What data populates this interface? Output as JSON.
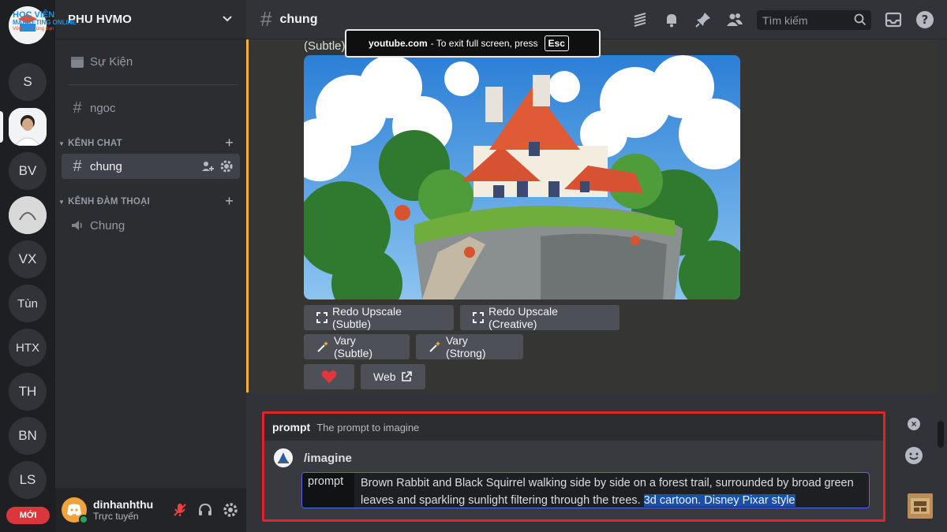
{
  "server_rail": {
    "servers": [
      {
        "abbr": "S"
      },
      {
        "abbr": "BV"
      },
      {
        "abbr": "VX"
      },
      {
        "abbr": "Tùn"
      },
      {
        "abbr": "HTX"
      },
      {
        "abbr": "TH"
      },
      {
        "abbr": "BN"
      },
      {
        "abbr": "LS"
      }
    ],
    "new_badge": "MỚI"
  },
  "guild": {
    "name": "PHU HVMO",
    "logo_text": "HỌC VIỆN",
    "logo_sub": "MARKETING ONLINE",
    "logo_tag": "Vững Ra Cùng Bạn"
  },
  "sidebar": {
    "events_label": "Sự Kiện",
    "channel_ngoc": "ngoc",
    "category_chat": "KÊNH CHAT",
    "channel_chung": "chung",
    "category_voice": "KÊNH ĐÀM THOẠI",
    "voice_chung": "Chung"
  },
  "user": {
    "name": "dinhanhthu",
    "status": "Trực tuyến"
  },
  "topbar": {
    "channel": "chung",
    "search_placeholder": "Tìm kiếm"
  },
  "message": {
    "subtle_text": "(Subtle)",
    "buttons": {
      "redo_subtle": "Redo Upscale (Subtle)",
      "redo_creative": "Redo Upscale (Creative)",
      "vary_subtle": "Vary (Subtle)",
      "vary_strong": "Vary (Strong)",
      "web": "Web"
    }
  },
  "fullscreen_toast": {
    "site": "youtube.com",
    "text": "-  To exit full screen, press",
    "key": "Esc"
  },
  "composer": {
    "option_name": "prompt",
    "option_desc": "The prompt to imagine",
    "command": "/imagine",
    "param_label": "prompt",
    "param_text": "Brown Rabbit and Black Squirrel walking side by side on a forest trail, surrounded by broad green leaves and sparkling sunlight filtering through the trees. ",
    "param_selected": "3d cartoon. Disney Pixar style"
  },
  "colors": {
    "accent": "#5865f2",
    "highlight": "#f0b232",
    "annotation_red": "#e3222a",
    "online": "#23a55a"
  }
}
